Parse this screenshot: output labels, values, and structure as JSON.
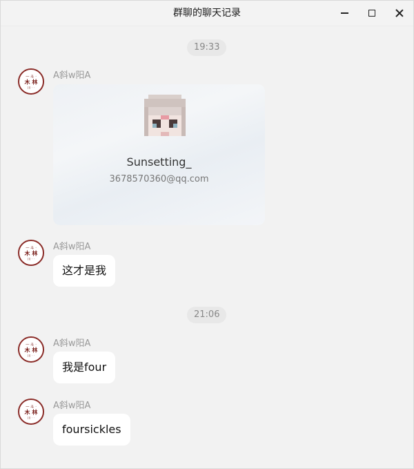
{
  "window": {
    "title": "群聊的聊天记录"
  },
  "timestamps": [
    "19:33",
    "21:06"
  ],
  "messages": [
    {
      "sender": "A斜w阳A",
      "type": "card",
      "card": {
        "name": "Sunsetting_",
        "email": "3678570360@qq.com"
      }
    },
    {
      "sender": "A斜w阳A",
      "type": "text",
      "text": "这才是我"
    },
    {
      "sender": "A斜w阳A",
      "type": "text",
      "text": "我是four"
    },
    {
      "sender": "A斜w阳A",
      "type": "text",
      "text": "foursickles"
    }
  ],
  "colors": {
    "background": "#f2f2f2",
    "bubble": "#ffffff",
    "avatar_ring": "#8a2b27",
    "timestamp_chip": "#e8e8e8"
  },
  "icons": [
    "minimize-icon",
    "maximize-icon",
    "close-icon",
    "avatar",
    "pixel-avatar"
  ]
}
